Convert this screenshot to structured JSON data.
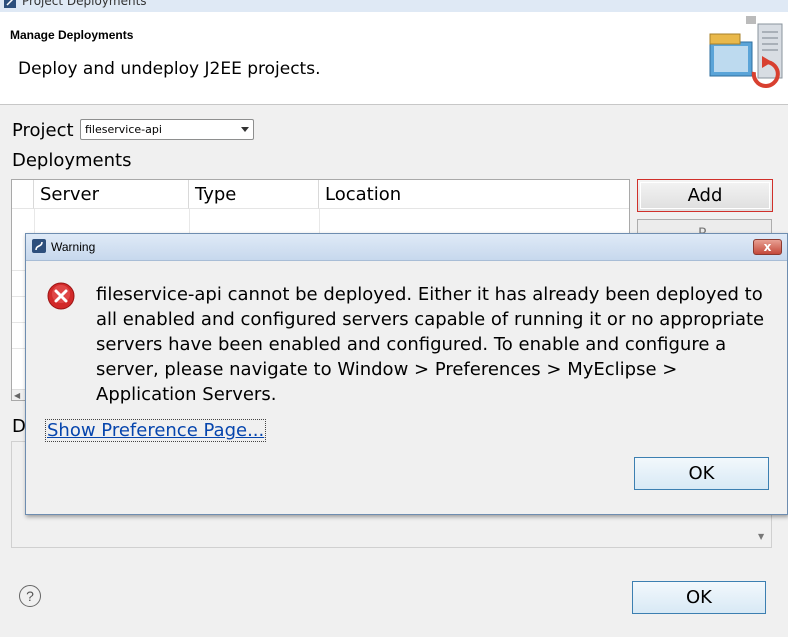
{
  "window": {
    "title": "Project Deployments"
  },
  "header": {
    "title": "Manage Deployments",
    "description": "Deploy and undeploy J2EE projects.",
    "graphic_icon": "deployment-server-icon"
  },
  "project": {
    "label": "Project",
    "selected": "fileservice-api"
  },
  "deployments": {
    "label": "Deployments",
    "columns": [
      "Server",
      "Type",
      "Location"
    ]
  },
  "buttons": {
    "add": "Add",
    "second_partial": "R",
    "ok": "OK"
  },
  "details": {
    "label_partial": "D"
  },
  "dialog": {
    "title": "Warning",
    "icon": "error-icon",
    "message": "fileservice-api cannot be deployed.  Either it has already been deployed to all enabled and configured servers capable of running it or no appropriate servers have been enabled and configured.  To enable and configure a server, please navigate to Window > Preferences > MyEclipse > Application Servers.",
    "link": "Show Preference Page...",
    "ok": "OK",
    "close": "x"
  },
  "help": {
    "icon": "help-icon",
    "glyph": "?"
  },
  "colors": {
    "link": "#0645ad",
    "error_red": "#d22a2a",
    "add_button_border": "#d0302a",
    "dialog_border": "#6e8db0"
  }
}
